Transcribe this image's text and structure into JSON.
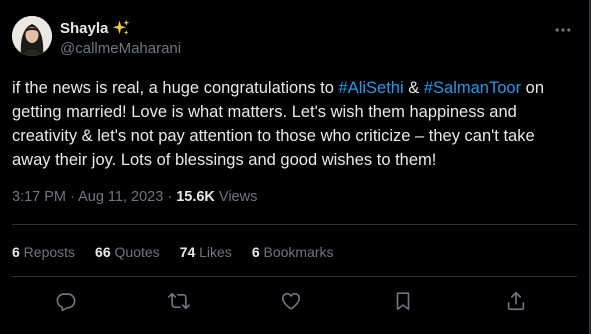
{
  "user": {
    "display_name": "Shayla",
    "handle": "@callmeMaharani"
  },
  "tweet": {
    "text_part1": "if the news is real, a huge congratulations to ",
    "hashtag1": "#AliSethi",
    "text_part2": " & ",
    "hashtag2": "#SalmanToor",
    "text_part3": " on getting married! Love is what matters. Let's wish them happiness and creativity & let's not pay attention to those who criticize – they can't take away their joy. Lots of blessings and good wishes to them!"
  },
  "meta": {
    "time": "3:17 PM",
    "separator": " · ",
    "date": "Aug 11, 2023",
    "views_count": "15.6K",
    "views_label": " Views"
  },
  "stats": {
    "reposts_count": "6",
    "reposts_label": " Reposts",
    "quotes_count": "66",
    "quotes_label": " Quotes",
    "likes_count": "74",
    "likes_label": " Likes",
    "bookmarks_count": "6",
    "bookmarks_label": " Bookmarks"
  },
  "icons": {
    "more": "more-icon",
    "reply": "reply-icon",
    "repost": "repost-icon",
    "like": "like-icon",
    "bookmark": "bookmark-icon",
    "share": "share-icon",
    "sparkle": "sparkles-icon"
  },
  "colors": {
    "background": "#000000",
    "text": "#e7e9ea",
    "secondary_text": "#71767b",
    "link": "#1d9bf0",
    "divider": "#2f3336",
    "sparkle": "#f4c542"
  }
}
